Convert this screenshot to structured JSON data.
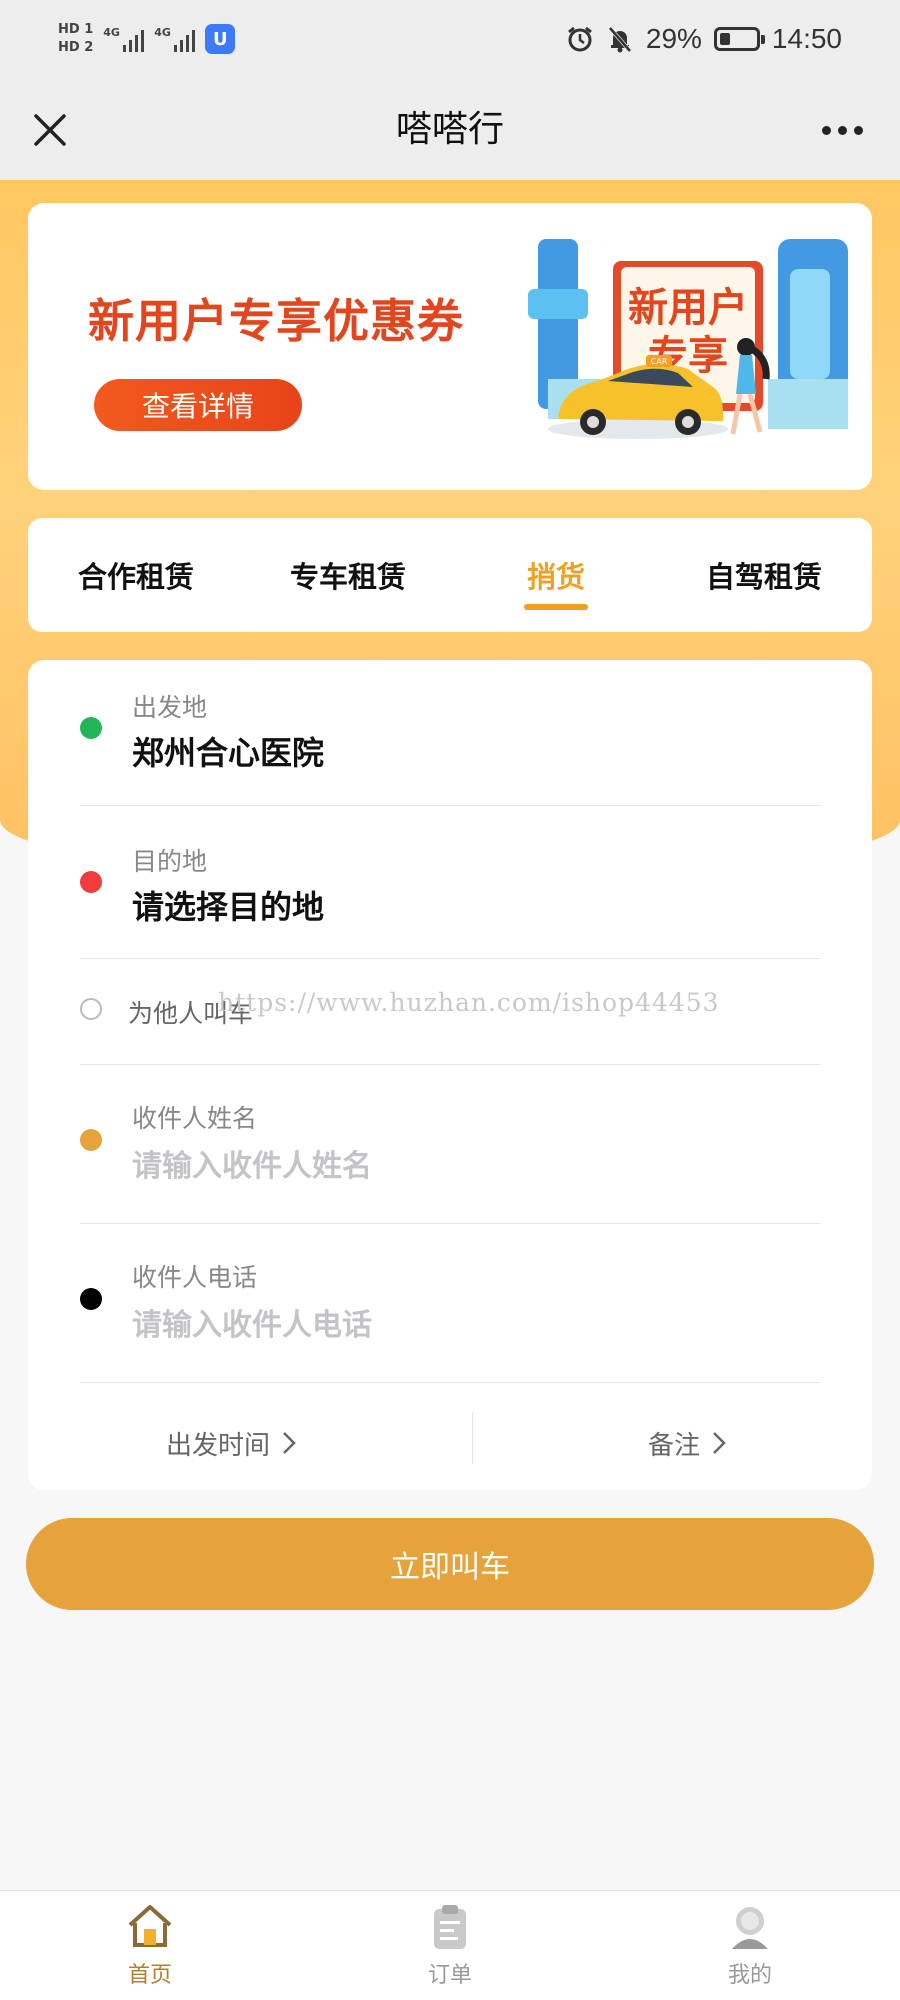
{
  "status_bar": {
    "hd_tags": [
      "HD 1",
      "HD 2"
    ],
    "network_1": "4G",
    "network_2": "4G",
    "app_badge_letter": "U",
    "battery_pct": "29%",
    "battery_level": 0.29,
    "clock": "14:50"
  },
  "nav": {
    "title": "嗒嗒行",
    "close_icon": "close-icon",
    "more_icon": "more-dots-icon"
  },
  "banner": {
    "title": "新用户专享优惠券",
    "button_label": "查看详情",
    "poster_line1": "新用户",
    "poster_line2": "专享",
    "car_tag": "CAR"
  },
  "tabs": {
    "items": [
      "合作租赁",
      "专车租赁",
      "捎货",
      "自驾租赁"
    ],
    "active_index": 2
  },
  "form": {
    "origin": {
      "label": "出发地",
      "value": "郑州合心医院"
    },
    "destination": {
      "label": "目的地",
      "value": "请选择目的地"
    },
    "for_others_label": "为他人叫车",
    "watermark": "https://www.huzhan.com/ishop44453",
    "receiver_name": {
      "label": "收件人姓名",
      "placeholder": "请输入收件人姓名"
    },
    "receiver_phone": {
      "label": "收件人电话",
      "placeholder": "请输入收件人电话"
    },
    "depart_time_label": "出发时间",
    "remarks_label": "备注"
  },
  "call_button_label": "立即叫车",
  "tab_bar": {
    "items": [
      {
        "label": "首页",
        "icon": "home-icon"
      },
      {
        "label": "订单",
        "icon": "order-clipboard-icon"
      },
      {
        "label": "我的",
        "icon": "profile-icon"
      }
    ],
    "active_index": 0
  },
  "colors": {
    "accent": "#e6a33c",
    "tab_active": "#f0a020",
    "banner_red": "#e2461e",
    "dot_origin": "#22b55a",
    "dot_destination": "#f23b3b",
    "dot_receiver_name": "#e6a33c",
    "dot_receiver_phone": "#000000"
  }
}
